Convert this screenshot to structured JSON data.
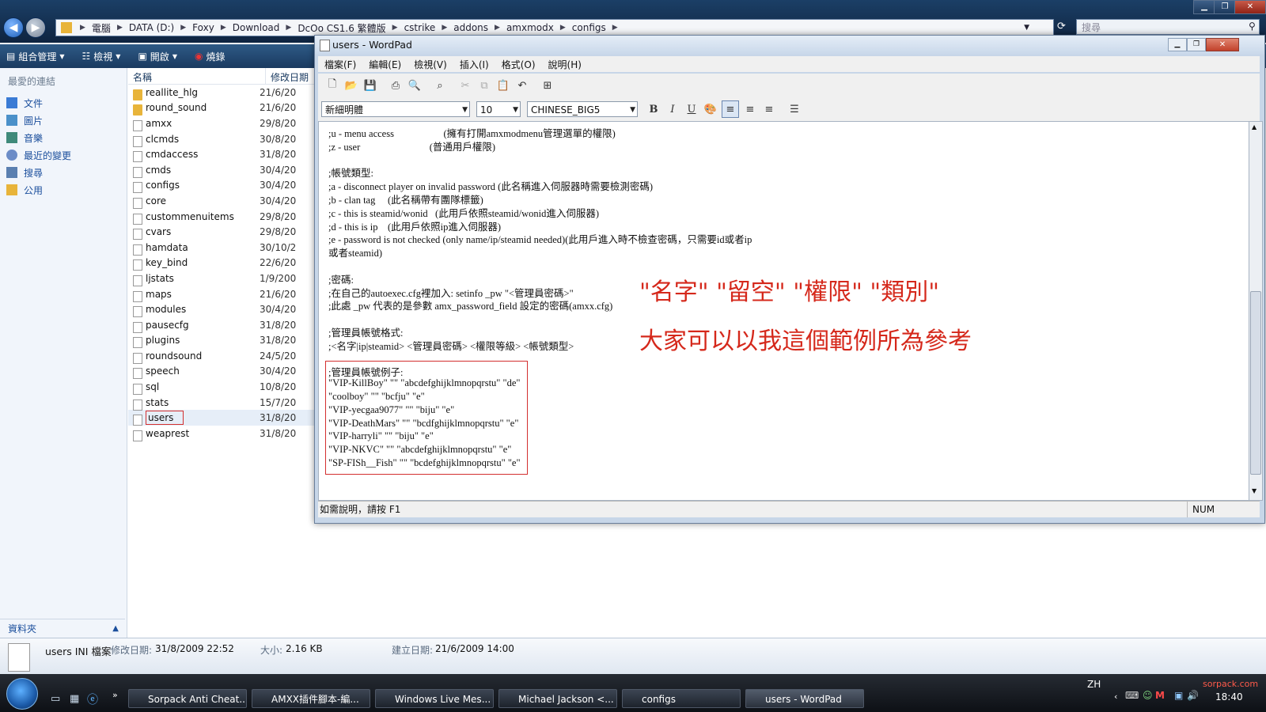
{
  "explorer": {
    "breadcrumbs": [
      "電腦",
      "DATA (D:)",
      "Foxy",
      "Download",
      "DcOo CS1.6 繁體版",
      "cstrike",
      "addons",
      "amxmodx",
      "configs"
    ],
    "search_placeholder": "搜尋",
    "toolbar": {
      "organize": "組合管理",
      "views": "檢視",
      "open": "開啟",
      "burn": "燒錄"
    },
    "favorites_heading": "最愛的連結",
    "favorites": [
      "文件",
      "圖片",
      "音樂",
      "最近的變更",
      "搜尋",
      "公用"
    ],
    "folders_label": "資料夾",
    "columns": {
      "name": "名稱",
      "modified": "修改日期"
    },
    "files": [
      {
        "name": "reallite_hlg",
        "date": "21/6/20",
        "type": "folder"
      },
      {
        "name": "round_sound",
        "date": "21/6/20",
        "type": "folder"
      },
      {
        "name": "amxx",
        "date": "29/8/20",
        "type": "file"
      },
      {
        "name": "clcmds",
        "date": "30/8/20",
        "type": "file"
      },
      {
        "name": "cmdaccess",
        "date": "31/8/20",
        "type": "file"
      },
      {
        "name": "cmds",
        "date": "30/4/20",
        "type": "file"
      },
      {
        "name": "configs",
        "date": "30/4/20",
        "type": "file"
      },
      {
        "name": "core",
        "date": "30/4/20",
        "type": "file"
      },
      {
        "name": "custommenuitems",
        "date": "29/8/20",
        "type": "file"
      },
      {
        "name": "cvars",
        "date": "29/8/20",
        "type": "file"
      },
      {
        "name": "hamdata",
        "date": "30/10/2",
        "type": "file"
      },
      {
        "name": "key_bind",
        "date": "22/6/20",
        "type": "file"
      },
      {
        "name": "ljstats",
        "date": "1/9/200",
        "type": "file"
      },
      {
        "name": "maps",
        "date": "21/6/20",
        "type": "file"
      },
      {
        "name": "modules",
        "date": "30/4/20",
        "type": "file"
      },
      {
        "name": "pausecfg",
        "date": "31/8/20",
        "type": "file"
      },
      {
        "name": "plugins",
        "date": "31/8/20",
        "type": "file"
      },
      {
        "name": "roundsound",
        "date": "24/5/20",
        "type": "file"
      },
      {
        "name": "speech",
        "date": "30/4/20",
        "type": "file"
      },
      {
        "name": "sql",
        "date": "10/8/20",
        "type": "file"
      },
      {
        "name": "stats",
        "date": "15/7/20",
        "type": "file"
      },
      {
        "name": "users",
        "date": "31/8/20",
        "type": "file"
      },
      {
        "name": "weaprest",
        "date": "31/8/20",
        "type": "file"
      }
    ],
    "details": {
      "file_name": "users INI 檔案",
      "modified_label": "修改日期:",
      "modified_value": "31/8/2009 22:52",
      "size_label": "大小:",
      "size_value": "2.16 KB",
      "created_label": "建立日期:",
      "created_value": "21/6/2009 14:00"
    }
  },
  "wordpad": {
    "title": "users - WordPad",
    "menu": [
      "檔案(F)",
      "編輯(E)",
      "檢視(V)",
      "插入(I)",
      "格式(O)",
      "說明(H)"
    ],
    "font": "新細明體",
    "size": "10",
    "script": "CHINESE_BIG5",
    "format_buttons": [
      "B",
      "I",
      "U"
    ],
    "document_lines": [
      ";u - menu access                    (擁有打開amxmodmenu管理選單的權限)",
      ";z - user                            (普通用戶權限)",
      "",
      ";帳號類型:",
      ";a - disconnect player on invalid password (此名稱進入伺服器時需要檢測密碼)",
      ";b - clan tag     (此名稱帶有團隊標籤)",
      ";c - this is steamid/wonid   (此用戶依照steamid/wonid進入伺服器)",
      ";d - this is ip    (此用戶依照ip進入伺服器)",
      ";e - password is not checked (only name/ip/steamid needed)(此用戶進入時不檢查密碼，只需要id或者ip",
      "或者steamid)",
      "",
      ";密碼:",
      ";在自己的autoexec.cfg裡加入: setinfo _pw \"<管理員密碼>\"",
      ";此處 _pw 代表的是參數 amx_password_field 設定的密碼(amxx.cfg)",
      "",
      ";管理員帳號格式:",
      ";<名字|ip|steamid> <管理員密碼> <權限等級> <帳號類型>",
      "",
      ";管理員帳號例子:",
      "\"VIP-KillBoy\" \"\" \"abcdefghijklmnopqrstu\" \"de\"",
      "\"coolboy\" \"\" \"bcfju\" \"e\"",
      "\"VIP-yecgaa9077\" \"\" \"biju\" \"e\"",
      "\"VIP-DeathMars\" \"\" \"bcdfghijklmnopqrstu\" \"e\"",
      "\"VIP-harryli\" \"\" \"biju\" \"e\"",
      "\"VIP-NKVC\" \"\" \"abcdefghijklmnopqrstu\" \"e\"",
      "\"SP-FISh__Fish\" \"\" \"bcdefghijklmnopqrstu\" \"e\""
    ],
    "annotation_1": "\"名字\" \"留空\" \"權限\" \"類別\"",
    "annotation_2": "大家可以以我這個範例所為參考",
    "status_left": "如需說明，請按 F1",
    "status_right": "NUM"
  },
  "taskbar": {
    "tasks": [
      "Sorpack Anti Cheat...",
      "AMXX插件腳本-編...",
      "Windows Live Mes...",
      "Michael Jackson <...",
      "configs",
      "users - WordPad"
    ],
    "lang": "ZH",
    "clock": "18:40",
    "watermark": "sorpack.com"
  },
  "colors": {
    "annotation": "#d5281b",
    "highlight_box": "#d32f2f",
    "taskbar": "#14181e"
  }
}
